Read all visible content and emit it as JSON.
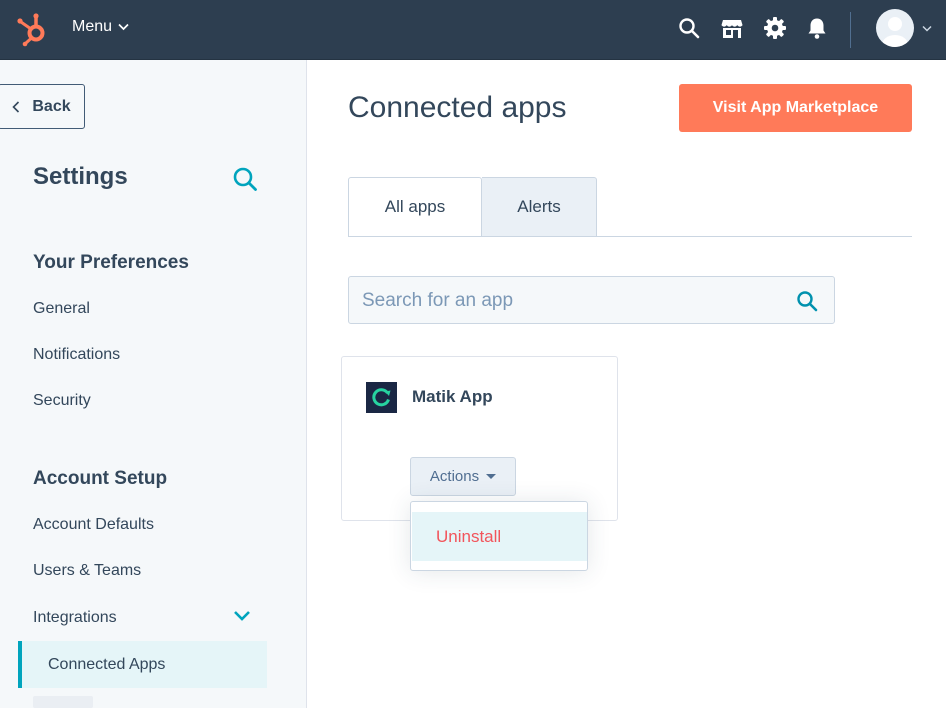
{
  "topnav": {
    "menu_label": "Menu",
    "icons": [
      "search-icon",
      "marketplace-icon",
      "gear-icon",
      "bell-icon",
      "avatar",
      "chevron-down-icon"
    ]
  },
  "sidebar": {
    "back_label": "Back",
    "title": "Settings",
    "sections": [
      {
        "heading": "Your Preferences",
        "items": [
          "General",
          "Notifications",
          "Security"
        ]
      },
      {
        "heading": "Account Setup",
        "items": [
          "Account Defaults",
          "Users & Teams",
          "Integrations"
        ]
      }
    ],
    "active_item": "Connected Apps"
  },
  "main": {
    "title": "Connected apps",
    "cta_label": "Visit App Marketplace",
    "tabs": [
      {
        "label": "All apps",
        "active": true
      },
      {
        "label": "Alerts",
        "active": false
      }
    ],
    "search": {
      "placeholder": "Search for an app",
      "value": ""
    },
    "app_card": {
      "name": "Matik App",
      "actions_label": "Actions",
      "dropdown_items": [
        "Uninstall"
      ]
    }
  },
  "colors": {
    "nav_bg": "#2d3e50",
    "accent_teal": "#00a4bd",
    "cta_orange": "#ff7a59",
    "danger_red": "#f2545b",
    "sidebar_bg": "#f5f8fa"
  }
}
